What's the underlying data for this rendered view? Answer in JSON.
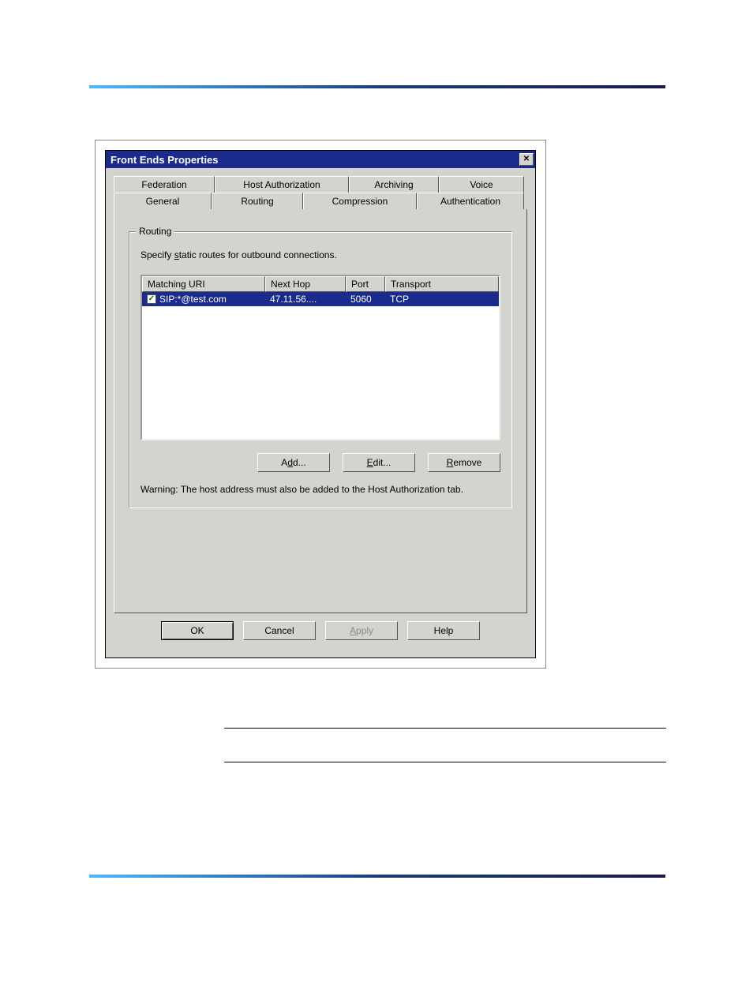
{
  "dialog": {
    "title": "Front Ends Properties",
    "close": "✕",
    "tabs_row1": [
      "Federation",
      "Host Authorization",
      "Archiving",
      "Voice"
    ],
    "tabs_row2": [
      "General",
      "Routing",
      "Compression",
      "Authentication"
    ],
    "active_tab": "Routing",
    "routing": {
      "group_label": "Routing",
      "hint_pre": "Specify ",
      "hint_u": "s",
      "hint_post": "tatic routes for outbound connections.",
      "columns": {
        "c1": "Matching URI",
        "c2": "Next Hop",
        "c3": "Port",
        "c4": "Transport"
      },
      "row": {
        "checked": "✓",
        "uri": "SIP:*@test.com",
        "hop": "47.11.56....",
        "port": "5060",
        "transport": "TCP"
      },
      "add_u": "d",
      "add_pre": "A",
      "add_post": "d...",
      "edit_u": "E",
      "edit_post": "dit...",
      "remove_u": "R",
      "remove_post": "emove",
      "warning": "Warning: The host address must also be added to the Host Authorization tab."
    },
    "buttons": {
      "ok": "OK",
      "cancel": "Cancel",
      "apply_u": "A",
      "apply_post": "pply",
      "help": "Help"
    }
  }
}
